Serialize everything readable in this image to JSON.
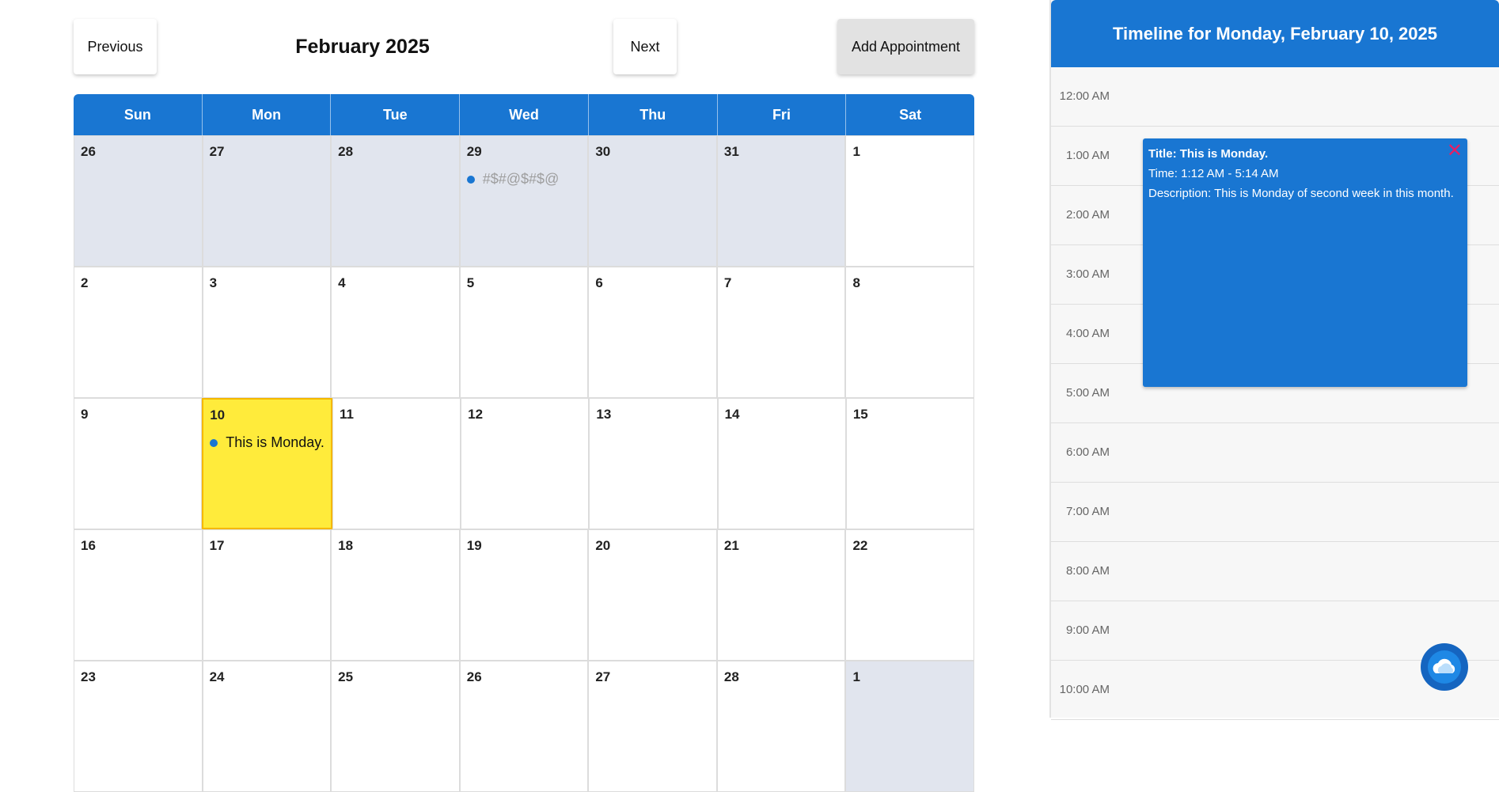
{
  "header": {
    "previous_label": "Previous",
    "month_title": "February 2025",
    "next_label": "Next",
    "add_label": "Add Appointment"
  },
  "calendar": {
    "days_of_week": [
      "Sun",
      "Mon",
      "Tue",
      "Wed",
      "Thu",
      "Fri",
      "Sat"
    ],
    "weeks": [
      [
        {
          "day": "26",
          "other": true
        },
        {
          "day": "27",
          "other": true
        },
        {
          "day": "28",
          "other": true
        },
        {
          "day": "29",
          "other": true,
          "event": "#$#@$#$@",
          "faded": true
        },
        {
          "day": "30",
          "other": true
        },
        {
          "day": "31",
          "other": true
        },
        {
          "day": "1"
        }
      ],
      [
        {
          "day": "2"
        },
        {
          "day": "3"
        },
        {
          "day": "4"
        },
        {
          "day": "5"
        },
        {
          "day": "6"
        },
        {
          "day": "7"
        },
        {
          "day": "8"
        }
      ],
      [
        {
          "day": "9"
        },
        {
          "day": "10",
          "selected": true,
          "event": "This is Monday."
        },
        {
          "day": "11"
        },
        {
          "day": "12"
        },
        {
          "day": "13"
        },
        {
          "day": "14"
        },
        {
          "day": "15"
        }
      ],
      [
        {
          "day": "16"
        },
        {
          "day": "17"
        },
        {
          "day": "18"
        },
        {
          "day": "19"
        },
        {
          "day": "20"
        },
        {
          "day": "21"
        },
        {
          "day": "22"
        }
      ],
      [
        {
          "day": "23"
        },
        {
          "day": "24"
        },
        {
          "day": "25"
        },
        {
          "day": "26"
        },
        {
          "day": "27"
        },
        {
          "day": "28"
        },
        {
          "day": "1",
          "other": true
        }
      ]
    ]
  },
  "timeline": {
    "title": "Timeline for Monday, February 10, 2025",
    "slots": [
      "12:00 AM",
      "1:00 AM",
      "2:00 AM",
      "3:00 AM",
      "4:00 AM",
      "5:00 AM",
      "6:00 AM",
      "7:00 AM",
      "8:00 AM",
      "9:00 AM",
      "10:00 AM"
    ],
    "appointment": {
      "title": "Title: This is Monday.",
      "time": "Time: 1:12 AM - 5:14 AM",
      "description": "Description: This is Monday of second week in this month.",
      "close_icon": "close-icon"
    }
  },
  "colors": {
    "primary": "#1976d2",
    "selected_day": "#ffeb3b",
    "other_month": "#e1e5ee",
    "close": "#e91e63"
  }
}
